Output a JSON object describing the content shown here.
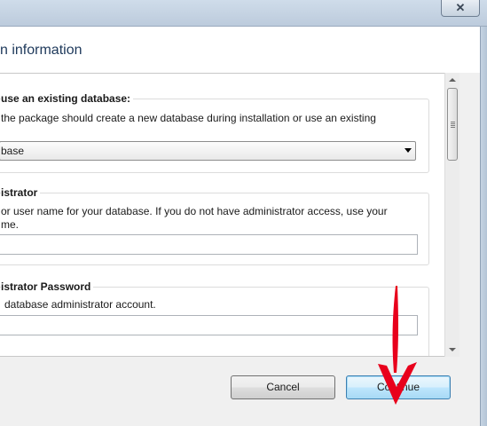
{
  "window": {
    "close_glyph": "✕"
  },
  "page": {
    "title": "n information"
  },
  "groups": [
    {
      "title": "use an existing database:",
      "text": "the package should create a new database during installation or use an existing",
      "select_value": "base"
    },
    {
      "title": "istrator",
      "text_line1": "or user name for your database. If you do not have administrator access, use your",
      "text_line2": "me.",
      "input_value": ""
    },
    {
      "title": "istrator Password",
      "text": "database administrator account.",
      "input_value": ""
    }
  ],
  "buttons": {
    "cancel": "Cancel",
    "continue": "Continue"
  },
  "colors": {
    "annotation_arrow": "#e8001c",
    "title_text": "#1e395b"
  }
}
